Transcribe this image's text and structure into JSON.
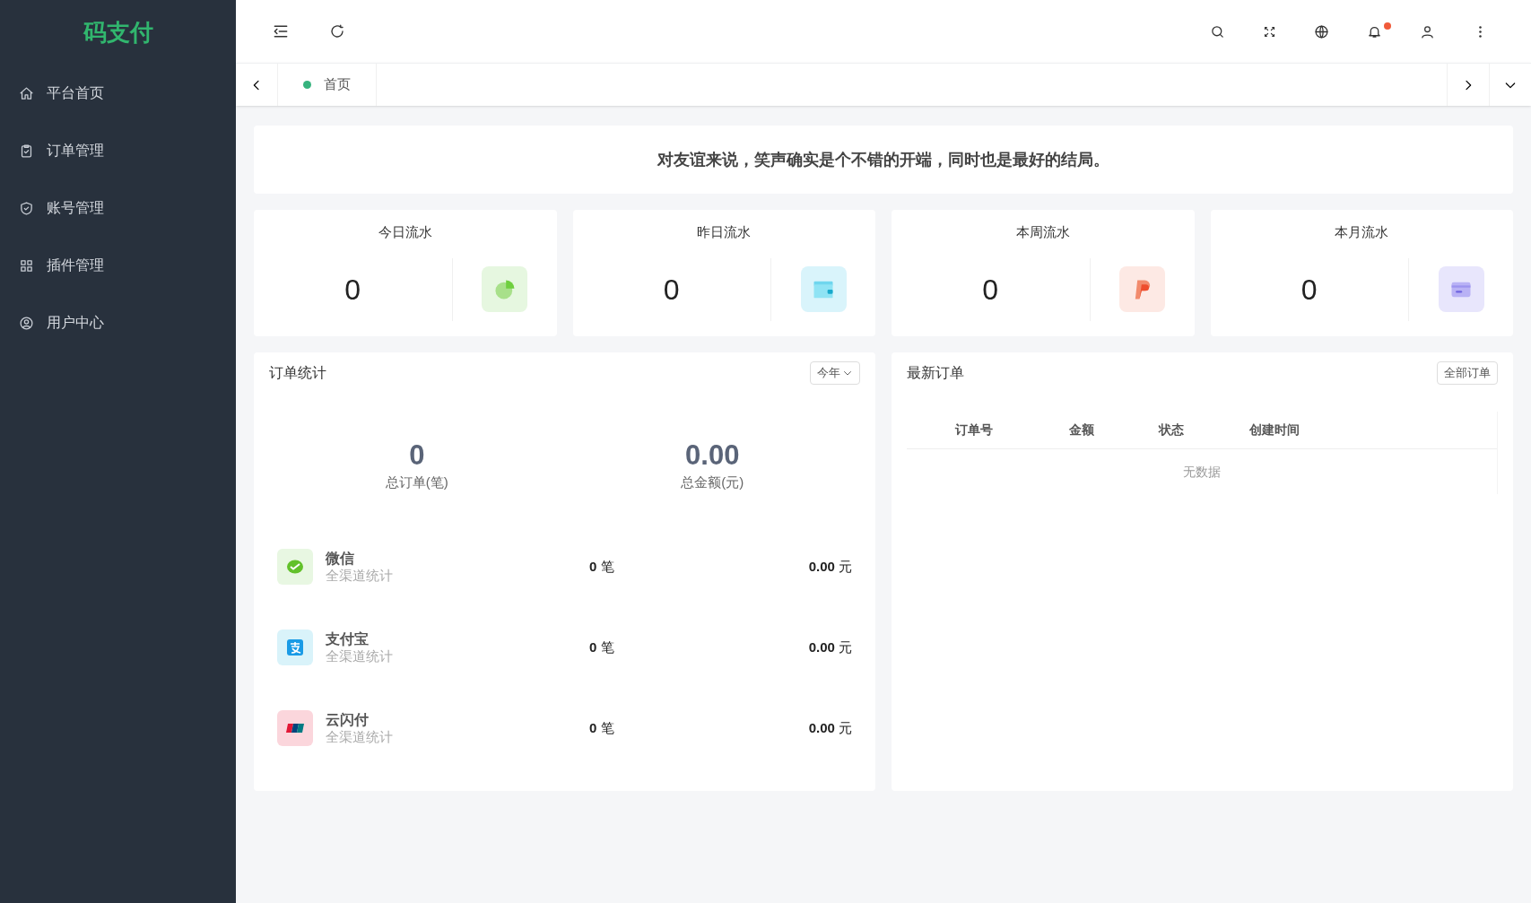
{
  "sidebar": {
    "logo": "码支付",
    "items": [
      {
        "label": "平台首页"
      },
      {
        "label": "订单管理"
      },
      {
        "label": "账号管理"
      },
      {
        "label": "插件管理"
      },
      {
        "label": "用户中心"
      }
    ]
  },
  "tabs": [
    {
      "label": "首页",
      "selected": true
    }
  ],
  "notification_dot": true,
  "banner": "对友谊来说，笑声确实是个不错的开端，同时也是最好的结局。",
  "stat_cards": [
    {
      "title": "今日流水",
      "value": "0",
      "color": "#e6f7e0"
    },
    {
      "title": "昨日流水",
      "value": "0",
      "color": "#d9f4fb"
    },
    {
      "title": "本周流水",
      "value": "0",
      "color": "#fde9e4"
    },
    {
      "title": "本月流水",
      "value": "0",
      "color": "#e8e6fc"
    }
  ],
  "order_stats": {
    "title": "订单统计",
    "period": "今年",
    "totals": [
      {
        "value": "0",
        "label": "总订单(笔)"
      },
      {
        "value": "0.00",
        "label": "总金额(元)"
      }
    ],
    "channels": [
      {
        "name": "微信",
        "sub": "全渠道统计",
        "count": "0",
        "count_unit": "笔",
        "amount": "0.00",
        "amount_unit": "元",
        "color": "#e8f7e2"
      },
      {
        "name": "支付宝",
        "sub": "全渠道统计",
        "count": "0",
        "count_unit": "笔",
        "amount": "0.00",
        "amount_unit": "元",
        "color": "#d9f3fa"
      },
      {
        "name": "云闪付",
        "sub": "全渠道统计",
        "count": "0",
        "count_unit": "笔",
        "amount": "0.00",
        "amount_unit": "元",
        "color": "#fbd6dc"
      }
    ]
  },
  "latest_orders": {
    "title": "最新订单",
    "button": "全部订单",
    "columns": [
      "订单号",
      "金额",
      "状态",
      "创建时间"
    ],
    "empty": "无数据"
  }
}
